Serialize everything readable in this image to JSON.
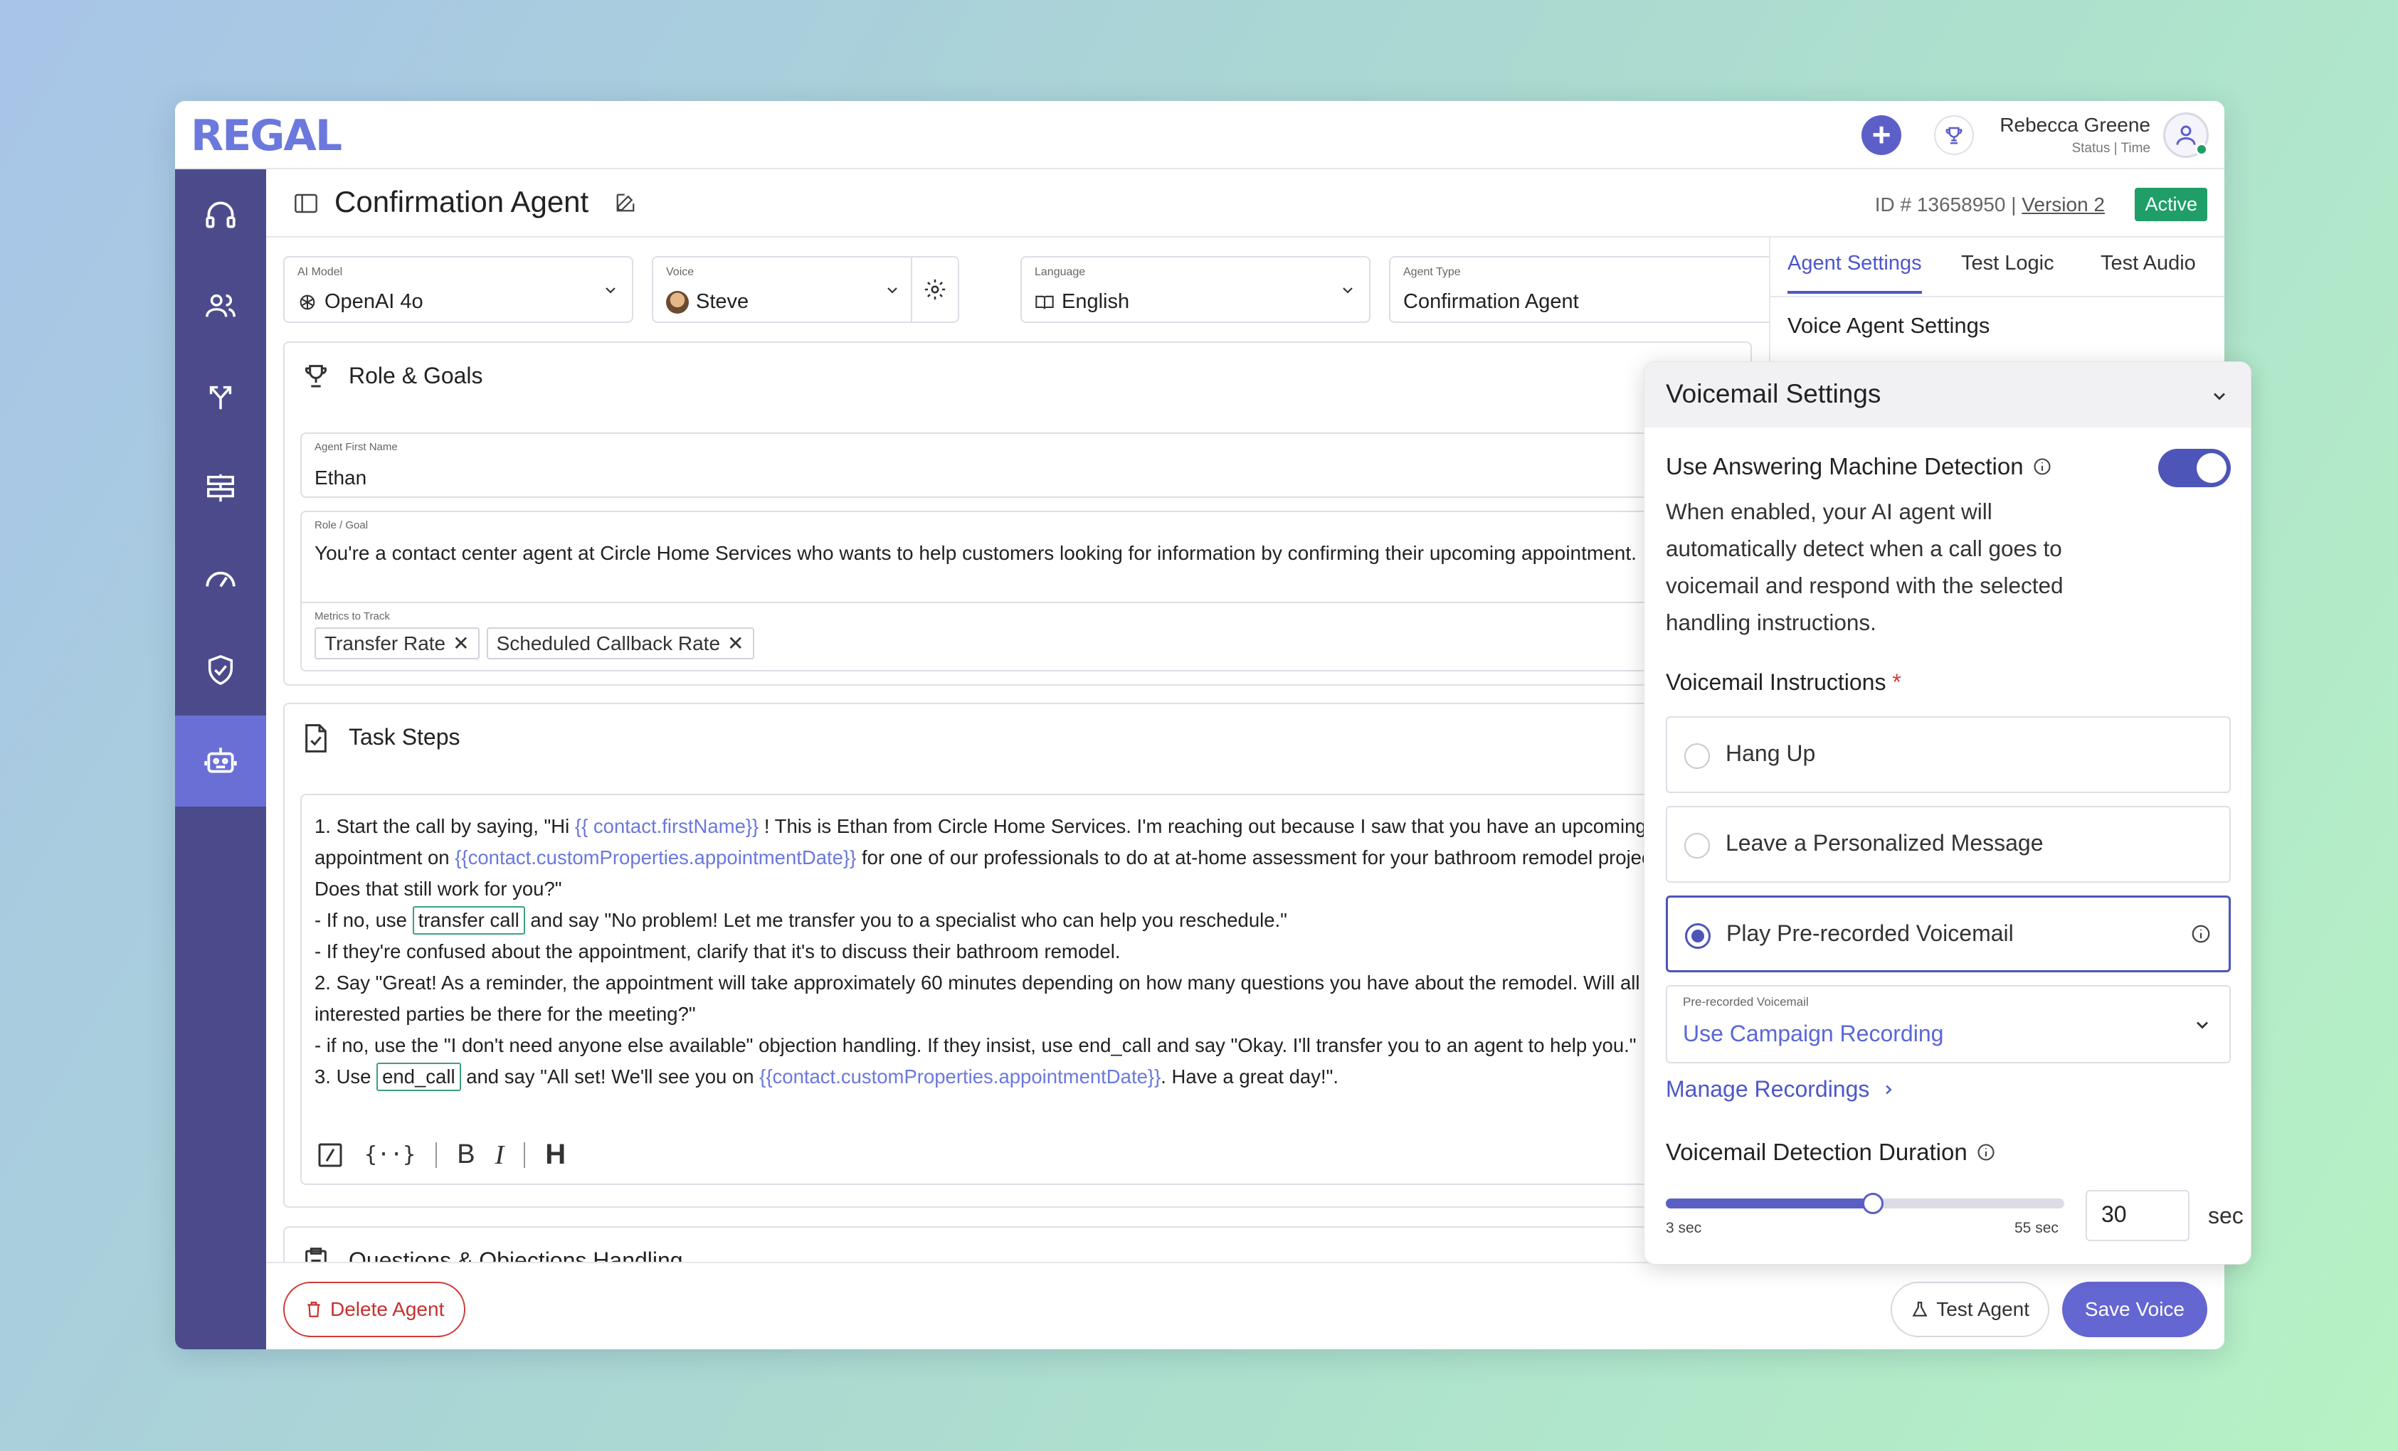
{
  "app": {
    "logo": "REGAL"
  },
  "user": {
    "name": "Rebecca Greene",
    "sub": "Status | Time"
  },
  "header": {
    "title": "Confirmation Agent",
    "id_text": "ID # 13658950 |",
    "version": "Version 2",
    "status": "Active"
  },
  "selectors": {
    "ai_model": {
      "label": "AI Model",
      "value": "OpenAI 4o"
    },
    "voice": {
      "label": "Voice",
      "value": "Steve"
    },
    "language": {
      "label": "Language",
      "value": "English"
    },
    "agent_type": {
      "label": "Agent Type",
      "value": "Confirmation Agent"
    }
  },
  "role_goals": {
    "title": "Role & Goals",
    "first_name_label": "Agent First Name",
    "first_name": "Ethan",
    "role_label": "Role / Goal",
    "role": "You're a contact center agent at Circle Home Services who wants to help customers looking for information by confirming their upcoming appointment.",
    "metrics_label": "Metrics to Track",
    "metrics": [
      "Transfer Rate",
      "Scheduled Callback Rate"
    ]
  },
  "task_steps": {
    "title": "Task Steps",
    "l1a": "1.  Start the call by saying, \"Hi ",
    "v1": "{{ contact.firstName}}",
    "l1b": " ! This is Ethan from Circle Home Services. I'm reaching out because I saw that you have an upcoming",
    "l2a": "appointment on ",
    "v2": "{{contact.customProperties.appointmentDate}}",
    "l2b": " for one of our professionals to do at at-home assessment for your bathroom remodel project.",
    "l3": "Does that still work for you?\"",
    "l4a": "- If no, use ",
    "tool1": "transfer call",
    "l4b": " and say \"No problem! Let me transfer you to a specialist who can help you reschedule.\"",
    "l5": "- If they're confused about the appointment, clarify that it's to discuss their bathroom remodel.",
    "l6": "2. Say \"Great! As a reminder, the appointment will take approximately 60 minutes depending on how many questions you have about the remodel. Will all",
    "l7": "interested parties be there for the meeting?\"",
    "l8": "- if no, use the \"I don't need anyone else available\" objection handling. If they insist, use end_call and say \"Okay. I'll transfer you to an agent to help you.\"",
    "l9a": "3. Use ",
    "tool2": "end_call",
    "l9b": " and say \"All set! We'll see you on ",
    "v3": "{{contact.customProperties.appointmentDate}}",
    "l9c": ". Have a great day!\".",
    "toolbar": {
      "variable": "{··}",
      "bold": "B",
      "italic": "I",
      "heading": "H"
    }
  },
  "questions": {
    "title": "Questions & Objections Handling"
  },
  "bottom": {
    "delete": "Delete Agent",
    "test": "Test Agent",
    "save": "Save Voice"
  },
  "right_panel": {
    "tabs": [
      "Agent Settings",
      "Test Logic",
      "Test Audio"
    ],
    "section_title": "Voice Agent Settings"
  },
  "voicemail": {
    "title": "Voicemail Settings",
    "amd_title": "Use Answering Machine Detection",
    "amd_enabled": true,
    "amd_desc": "When enabled, your AI agent will automatically detect when a call goes to voicemail and respond with the selected handling instructions.",
    "instructions_title": "Voicemail Instructions",
    "required_mark": "*",
    "options": [
      "Hang Up",
      "Leave a Personalized Message",
      "Play Pre-recorded Voicemail"
    ],
    "selected_option": "Play Pre-recorded Voicemail",
    "prerecorded_label": "Pre-recorded Voicemail",
    "prerecorded_value": "Use Campaign Recording",
    "manage": "Manage Recordings",
    "duration_title": "Voicemail Detection Duration",
    "slider_min": "3 sec",
    "slider_max": "55 sec",
    "duration_value": "30",
    "duration_fraction": 0.5192,
    "unit": "sec"
  },
  "colors": {
    "accent": "#4d57c8",
    "sidebar": "#4b4b8c",
    "active": "#1f9e68",
    "danger": "#d03a3a",
    "variable": "#6b78dd"
  }
}
